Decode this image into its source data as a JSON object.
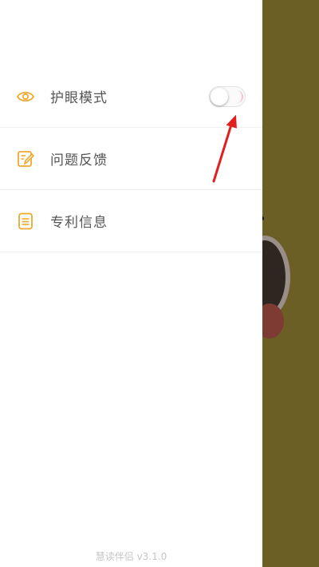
{
  "drawer": {
    "items": [
      {
        "label": "护眼模式",
        "icon": "eye-icon",
        "toggle_on": false
      },
      {
        "label": "问题反馈",
        "icon": "edit-note-icon"
      },
      {
        "label": "专利信息",
        "icon": "document-list-icon"
      }
    ],
    "version": "慧读伴侣 v3.1.0"
  },
  "colors": {
    "icon_accent": "#f0a830",
    "background_app": "#6b5f26",
    "arrow": "#e02020"
  }
}
